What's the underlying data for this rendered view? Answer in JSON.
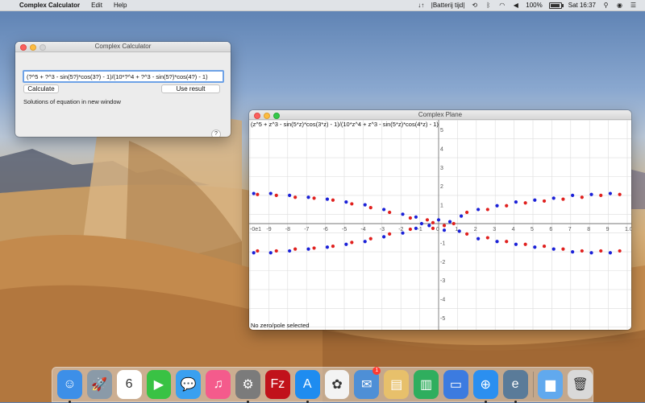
{
  "menubar": {
    "app_name": "Complex Calculator",
    "menus": [
      "Edit",
      "Help"
    ],
    "battery_label": "|Batterij tijd|",
    "battery_percent": "100%",
    "clock": "Sat 16:37"
  },
  "calculator": {
    "title": "Complex Calculator",
    "expression": "(?^5 + ?^3 - sin(5?)*cos(3?) - 1)/(10*?^4 + ?^3 - sin(5?)*cos(4?) - 1)",
    "calculate_label": "Calculate",
    "use_result_label": "Use result",
    "status": "Solutions of equation in new window",
    "help_label": "?"
  },
  "plane": {
    "title": "Complex Plane",
    "expression": "(z^5 + z^3 - sin(5*z)*cos(3*z) - 1)/(10*z^4 + z^3 - sin(5*z)*cos(4*z) - 1)",
    "status": "No zero/pole selected",
    "x_ticks": [
      "-0e1",
      "-9",
      "-8",
      "-7",
      "-6",
      "-5",
      "-4",
      "-3",
      "-2",
      "-1",
      "0",
      "1",
      "2",
      "3",
      "4",
      "5",
      "6",
      "7",
      "8",
      "9",
      "1.0"
    ],
    "y_ticks": [
      "5",
      "4",
      "3",
      "2",
      "1",
      "0",
      "-1",
      "-2",
      "-3",
      "-4",
      "-5"
    ],
    "colors": {
      "zero": "#e0201e",
      "pole": "#1a20d8",
      "grid": "#dcdcdc",
      "axis": "#777777"
    }
  },
  "chart_data": {
    "type": "scatter",
    "xlim": [
      -10,
      10
    ],
    "ylim": [
      -5,
      5
    ],
    "grid": true,
    "series": [
      {
        "name": "",
        "color": "#e0201e",
        "points": [
          [
            -9.6,
            1.55
          ],
          [
            -8.6,
            1.5
          ],
          [
            -7.6,
            1.4
          ],
          [
            -6.6,
            1.35
          ],
          [
            -5.6,
            1.25
          ],
          [
            -4.6,
            1.05
          ],
          [
            -3.6,
            0.85
          ],
          [
            -2.6,
            0.6
          ],
          [
            -1.5,
            0.3
          ],
          [
            -0.6,
            0.2
          ],
          [
            -0.3,
            0.05
          ],
          [
            0.3,
            -0.1
          ],
          [
            0.8,
            0.0
          ],
          [
            1.5,
            0.6
          ],
          [
            2.6,
            0.75
          ],
          [
            3.6,
            0.95
          ],
          [
            4.6,
            1.1
          ],
          [
            5.6,
            1.2
          ],
          [
            6.6,
            1.3
          ],
          [
            7.6,
            1.4
          ],
          [
            8.6,
            1.5
          ],
          [
            9.6,
            1.55
          ],
          [
            -9.6,
            -1.45
          ],
          [
            -8.6,
            -1.45
          ],
          [
            -7.6,
            -1.35
          ],
          [
            -6.6,
            -1.3
          ],
          [
            -5.6,
            -1.2
          ],
          [
            -4.6,
            -1.0
          ],
          [
            -3.6,
            -0.8
          ],
          [
            -2.6,
            -0.55
          ],
          [
            -1.5,
            -0.3
          ],
          [
            -0.3,
            -0.25
          ],
          [
            1.5,
            -0.55
          ],
          [
            2.6,
            -0.75
          ],
          [
            3.6,
            -0.95
          ],
          [
            4.6,
            -1.1
          ],
          [
            5.6,
            -1.2
          ],
          [
            6.6,
            -1.35
          ],
          [
            7.6,
            -1.45
          ],
          [
            8.6,
            -1.45
          ],
          [
            9.6,
            -1.45
          ]
        ]
      },
      {
        "name": "",
        "color": "#1a20d8",
        "points": [
          [
            -9.8,
            1.6
          ],
          [
            -8.9,
            1.6
          ],
          [
            -7.9,
            1.5
          ],
          [
            -6.9,
            1.4
          ],
          [
            -5.9,
            1.3
          ],
          [
            -4.9,
            1.15
          ],
          [
            -3.9,
            1.0
          ],
          [
            -2.9,
            0.75
          ],
          [
            -1.9,
            0.5
          ],
          [
            -1.2,
            0.35
          ],
          [
            -0.9,
            0.0
          ],
          [
            0.0,
            0.2
          ],
          [
            0.6,
            0.1
          ],
          [
            1.2,
            0.4
          ],
          [
            2.1,
            0.75
          ],
          [
            3.1,
            0.95
          ],
          [
            4.1,
            1.15
          ],
          [
            5.1,
            1.25
          ],
          [
            6.1,
            1.35
          ],
          [
            7.1,
            1.5
          ],
          [
            8.1,
            1.55
          ],
          [
            9.1,
            1.6
          ],
          [
            -9.8,
            -1.55
          ],
          [
            -8.9,
            -1.55
          ],
          [
            -7.9,
            -1.45
          ],
          [
            -6.9,
            -1.35
          ],
          [
            -5.9,
            -1.25
          ],
          [
            -4.9,
            -1.1
          ],
          [
            -3.9,
            -0.95
          ],
          [
            -2.9,
            -0.7
          ],
          [
            -1.9,
            -0.5
          ],
          [
            -1.2,
            -0.25
          ],
          [
            -0.5,
            -0.1
          ],
          [
            0.3,
            -0.35
          ],
          [
            1.1,
            -0.4
          ],
          [
            2.1,
            -0.8
          ],
          [
            3.1,
            -0.95
          ],
          [
            4.1,
            -1.1
          ],
          [
            5.1,
            -1.25
          ],
          [
            6.1,
            -1.35
          ],
          [
            7.1,
            -1.5
          ],
          [
            8.1,
            -1.55
          ],
          [
            9.1,
            -1.55
          ]
        ]
      }
    ]
  },
  "dock": {
    "items": [
      {
        "name": "finder-icon",
        "glyph": "☺",
        "bg": "#3d8fe8",
        "running": true
      },
      {
        "name": "launchpad-icon",
        "glyph": "🚀",
        "bg": "#8a9aa8",
        "running": false
      },
      {
        "name": "calendar-icon",
        "glyph": "6",
        "bg": "#ffffff",
        "running": false
      },
      {
        "name": "facetime-icon",
        "glyph": "▶",
        "bg": "#39c244",
        "running": false
      },
      {
        "name": "messages-icon",
        "glyph": "💬",
        "bg": "#3aa0f0",
        "running": false
      },
      {
        "name": "itunes-icon",
        "glyph": "♫",
        "bg": "#f45b8c",
        "running": false
      },
      {
        "name": "system-preferences-icon",
        "glyph": "⚙",
        "bg": "#7b7b7b",
        "running": true
      },
      {
        "name": "filezilla-icon",
        "glyph": "Fz",
        "bg": "#c1121b",
        "running": false
      },
      {
        "name": "app-store-icon",
        "glyph": "A",
        "bg": "#1e8cf0",
        "running": true
      },
      {
        "name": "photos-icon",
        "glyph": "✿",
        "bg": "#f3f3f3",
        "running": false
      },
      {
        "name": "mail-icon",
        "glyph": "✉",
        "bg": "#4e8fd6",
        "running": false,
        "badge": "1"
      },
      {
        "name": "preview-icon",
        "glyph": "▤",
        "bg": "#e7c06b",
        "running": false
      },
      {
        "name": "numbers-icon",
        "glyph": "▥",
        "bg": "#2fae5e",
        "running": false
      },
      {
        "name": "keynote-icon",
        "glyph": "▭",
        "bg": "#3c7be0",
        "running": false
      },
      {
        "name": "safari-icon",
        "glyph": "⊕",
        "bg": "#2b8ff0",
        "running": true
      },
      {
        "name": "complex-calculator-icon",
        "glyph": "e",
        "bg": "#5a7b99",
        "running": true
      }
    ],
    "tail": [
      {
        "name": "downloads-folder-icon",
        "glyph": "▆",
        "bg": "#61a9ee"
      },
      {
        "name": "trash-icon",
        "glyph": "🗑",
        "bg": "#d9d9d9"
      }
    ]
  }
}
